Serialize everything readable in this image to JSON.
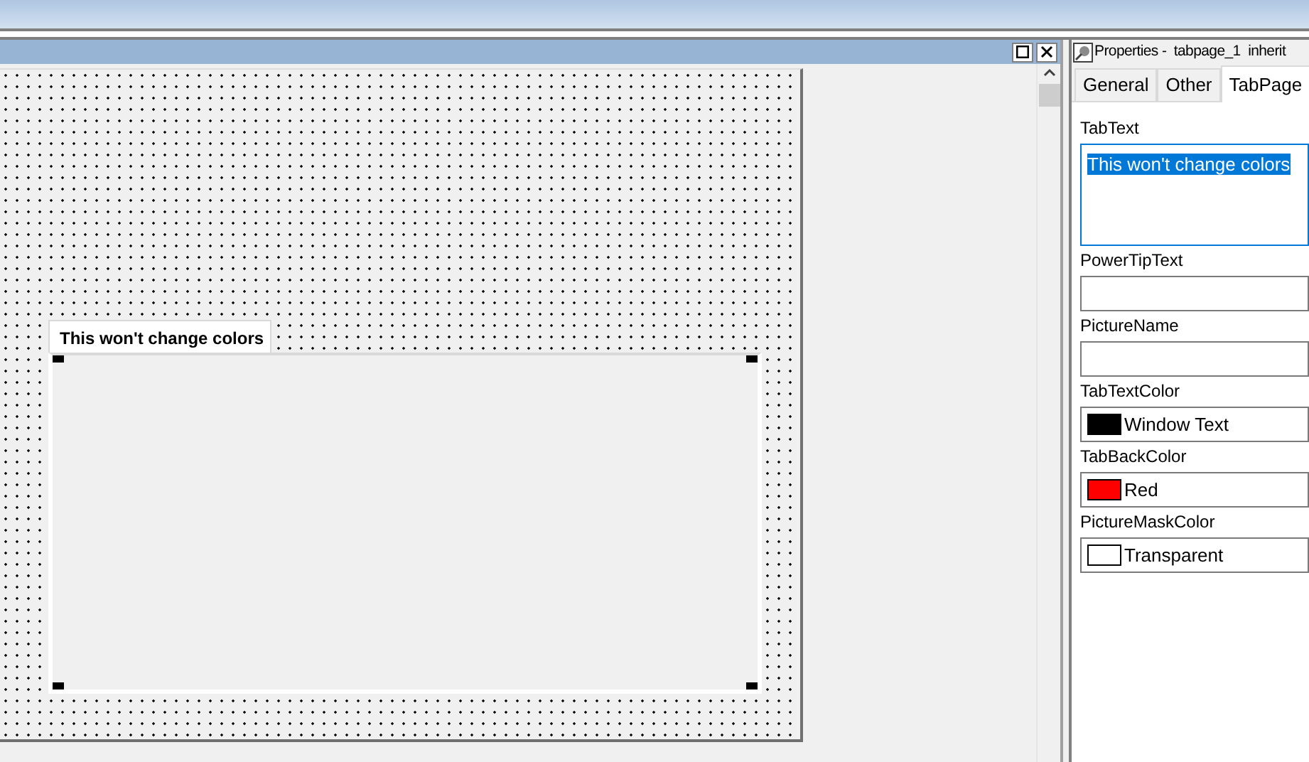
{
  "designer": {
    "form_tab": {
      "label": "This won't change colors"
    }
  },
  "properties": {
    "title": "Properties -  tabpage_1  inherit",
    "tabs": [
      {
        "label": "General",
        "selected": false
      },
      {
        "label": "Other",
        "selected": false
      },
      {
        "label": "TabPage",
        "selected": true
      }
    ],
    "fields": [
      {
        "kind": "multiline",
        "label": "TabText",
        "value": "This won't change colors",
        "text_selected": true
      },
      {
        "kind": "text",
        "label": "PowerTipText",
        "text_selected": false
      },
      {
        "kind": "text",
        "label": "PictureName",
        "text_selected": false
      },
      {
        "kind": "color",
        "label": "TabTextColor",
        "value": "Window Text",
        "color": "#000000"
      },
      {
        "kind": "color",
        "label": "TabBackColor",
        "value": "Red",
        "color": "#ff0000"
      },
      {
        "kind": "color",
        "label": "PictureMaskColor",
        "value": "Transparent",
        "color": "#ffffff"
      }
    ]
  }
}
